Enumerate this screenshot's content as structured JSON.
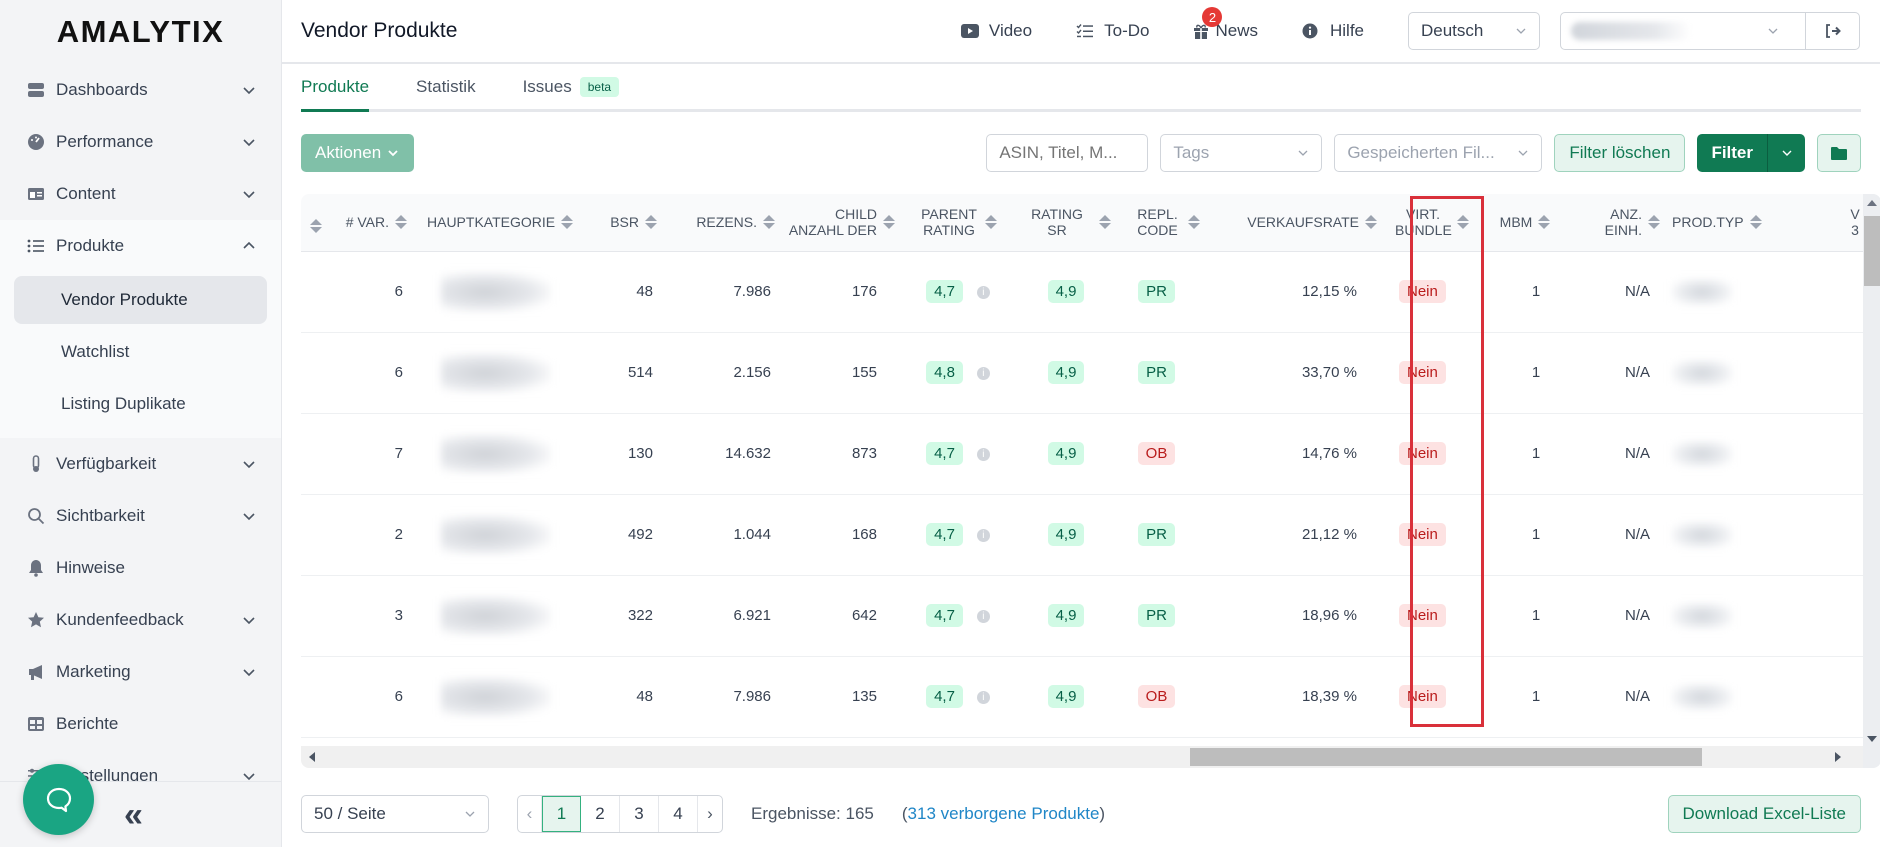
{
  "sidebar": {
    "logo": "AMALYTIX",
    "items": [
      {
        "label": "Dashboards",
        "icon": "server-icon",
        "expandable": true
      },
      {
        "label": "Performance",
        "icon": "gauge-icon",
        "expandable": true
      },
      {
        "label": "Content",
        "icon": "id-card-icon",
        "expandable": true
      },
      {
        "label": "Produkte",
        "icon": "list-icon",
        "expandable": true,
        "open": true,
        "children": [
          {
            "label": "Vendor Produkte",
            "active": true
          },
          {
            "label": "Watchlist"
          },
          {
            "label": "Listing Duplikate"
          }
        ]
      },
      {
        "label": "Verfügbarkeit",
        "icon": "thermometer-icon",
        "expandable": true
      },
      {
        "label": "Sichtbarkeit",
        "icon": "search-icon",
        "expandable": true
      },
      {
        "label": "Hinweise",
        "icon": "bell-icon",
        "expandable": false
      },
      {
        "label": "Kundenfeedback",
        "icon": "star-icon",
        "expandable": true
      },
      {
        "label": "Marketing",
        "icon": "megaphone-icon",
        "expandable": true
      },
      {
        "label": "Berichte",
        "icon": "table-icon",
        "expandable": false
      },
      {
        "label": "Einstellungen",
        "icon": "sliders-icon",
        "expandable": true
      }
    ],
    "collapse_label": "«"
  },
  "header": {
    "title": "Vendor Produkte",
    "links": [
      {
        "label": "Video",
        "icon": "video-icon"
      },
      {
        "label": "To-Do",
        "icon": "checklist-icon"
      },
      {
        "label": "News",
        "icon": "gift-icon",
        "badge": "2"
      },
      {
        "label": "Hilfe",
        "icon": "info-icon"
      }
    ],
    "language": "Deutsch",
    "account": ""
  },
  "tabs": [
    {
      "label": "Produkte",
      "active": true
    },
    {
      "label": "Statistik"
    },
    {
      "label": "Issues",
      "badge": "beta"
    }
  ],
  "toolbar": {
    "actions_label": "Aktionen",
    "search_placeholder": "ASIN, Titel, M...",
    "tags_placeholder": "Tags",
    "saved_filter_placeholder": "Gespeicherten Fil...",
    "clear_filter_label": "Filter löschen",
    "filter_label": "Filter"
  },
  "table": {
    "columns": [
      "# VAR.",
      "HAUPTKATEGORIE",
      "BSR",
      "REZENS.",
      "CHILD ANZAHL DER",
      "PARENT RATING",
      "RATING SR",
      "REPL. CODE",
      "VERKAUFSRATE",
      "VIRT. BUNDLE",
      "MBM",
      "ANZ. EINH.",
      "PROD.TYP",
      "V 3"
    ],
    "highlighted_column": "REPL. CODE",
    "rows": [
      {
        "var": "6",
        "bsr": "48",
        "rezens": "7.986",
        "child": "176",
        "parent_rating": "4,7",
        "rating_sr": "4,9",
        "repl_code": "PR",
        "verkaufsrate": "12,15 %",
        "virt_bundle": "Nein",
        "mbm": "1",
        "anz_einh": "N/A"
      },
      {
        "var": "6",
        "bsr": "514",
        "rezens": "2.156",
        "child": "155",
        "parent_rating": "4,8",
        "rating_sr": "4,9",
        "repl_code": "PR",
        "verkaufsrate": "33,70 %",
        "virt_bundle": "Nein",
        "mbm": "1",
        "anz_einh": "N/A"
      },
      {
        "var": "7",
        "bsr": "130",
        "rezens": "14.632",
        "child": "873",
        "parent_rating": "4,7",
        "rating_sr": "4,9",
        "repl_code": "OB",
        "verkaufsrate": "14,76 %",
        "virt_bundle": "Nein",
        "mbm": "1",
        "anz_einh": "N/A"
      },
      {
        "var": "2",
        "bsr": "492",
        "rezens": "1.044",
        "child": "168",
        "parent_rating": "4,7",
        "rating_sr": "4,9",
        "repl_code": "PR",
        "verkaufsrate": "21,12 %",
        "virt_bundle": "Nein",
        "mbm": "1",
        "anz_einh": "N/A"
      },
      {
        "var": "3",
        "bsr": "322",
        "rezens": "6.921",
        "child": "642",
        "parent_rating": "4,7",
        "rating_sr": "4,9",
        "repl_code": "PR",
        "verkaufsrate": "18,96 %",
        "virt_bundle": "Nein",
        "mbm": "1",
        "anz_einh": "N/A"
      },
      {
        "var": "6",
        "bsr": "48",
        "rezens": "7.986",
        "child": "135",
        "parent_rating": "4,7",
        "rating_sr": "4,9",
        "repl_code": "OB",
        "verkaufsrate": "18,39 %",
        "virt_bundle": "Nein",
        "mbm": "1",
        "anz_einh": "N/A"
      }
    ]
  },
  "footer": {
    "per_page": "50 / Seite",
    "pages": [
      "1",
      "2",
      "3",
      "4"
    ],
    "current_page": "1",
    "results_label": "Ergebnisse: 165",
    "hidden_prefix": "(",
    "hidden_link": "313 verborgene Produkte",
    "hidden_suffix": ")",
    "download_label": "Download Excel-Liste"
  },
  "colors": {
    "brand_green": "#107a53",
    "pill_green_bg": "#d1fae5",
    "pill_red_bg": "#fde2e2",
    "highlight_red": "#d9303a",
    "chat_green": "#1aa583",
    "link_blue": "#1f86c7"
  }
}
